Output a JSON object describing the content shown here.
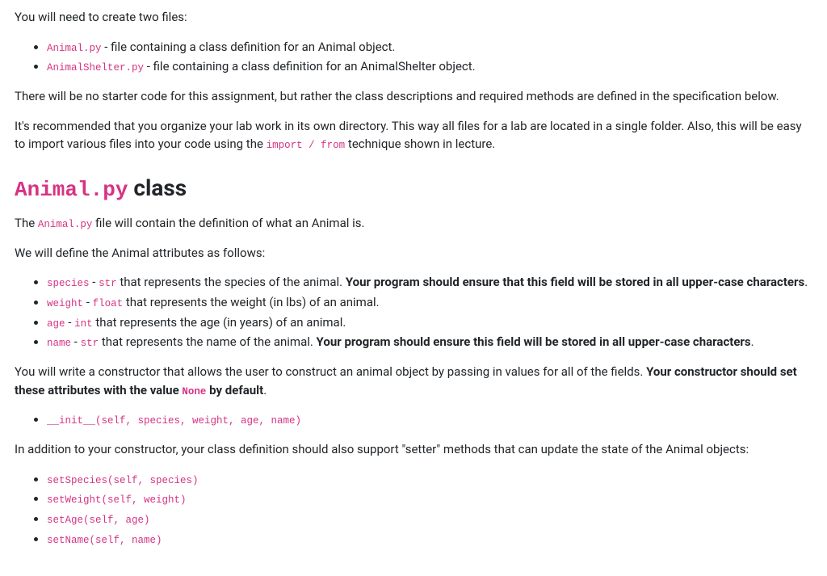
{
  "intro": {
    "need_to_create": "You will need to create two files:",
    "files": [
      {
        "filename": "Animal.py",
        "desc": " - file containing a class definition for an Animal object."
      },
      {
        "filename": "AnimalShelter.py",
        "desc": " - file containing a class definition for an AnimalShelter object."
      }
    ],
    "no_starter": "There will be no starter code for this assignment, but rather the class descriptions and required methods are defined in the specification below.",
    "recommend_prefix": "It's recommended that you organize your lab work in its own directory. This way all files for a lab are located in a single folder. Also, this will be easy to import various files into your code using the ",
    "import_code": "import / from",
    "recommend_suffix": " technique shown in lecture."
  },
  "section": {
    "heading_code": "Animal.py",
    "heading_text": " class",
    "file_sentence_prefix": "The ",
    "file_sentence_code": "Animal.py",
    "file_sentence_suffix": " file will contain the definition of what an Animal is.",
    "attrs_intro": "We will define the Animal attributes as follows:",
    "attributes": [
      {
        "name": "species",
        "dash": " - ",
        "type": "str",
        "desc": " that represents the species of the animal. ",
        "bold": "Your program should ensure that this field will be stored in all upper-case characters",
        "tail": "."
      },
      {
        "name": "weight",
        "dash": " - ",
        "type": "float",
        "desc": " that represents the weight (in lbs) of an animal.",
        "bold": "",
        "tail": ""
      },
      {
        "name": "age",
        "dash": " - ",
        "type": "int",
        "desc": " that represents the age (in years) of an animal.",
        "bold": "",
        "tail": ""
      },
      {
        "name": "name",
        "dash": " - ",
        "type": "str",
        "desc": " that represents the name of the animal. ",
        "bold": "Your program should ensure this field will be stored in all upper-case characters",
        "tail": "."
      }
    ],
    "ctor_para_prefix": "You will write a constructor that allows the user to construct an animal object by passing in values for all of the fields. ",
    "ctor_para_bold1": "Your constructor should set these attributes with the value ",
    "ctor_para_code": "None",
    "ctor_para_bold2": " by default",
    "ctor_para_suffix": ".",
    "constructor": "__init__(self, species, weight, age, name)",
    "setters_intro": "In addition to your constructor, your class definition should also support \"setter\" methods that can update the state of the Animal objects:",
    "setters": [
      "setSpecies(self, species)",
      "setWeight(self, weight)",
      "setAge(self, age)",
      "setName(self, name)"
    ]
  }
}
